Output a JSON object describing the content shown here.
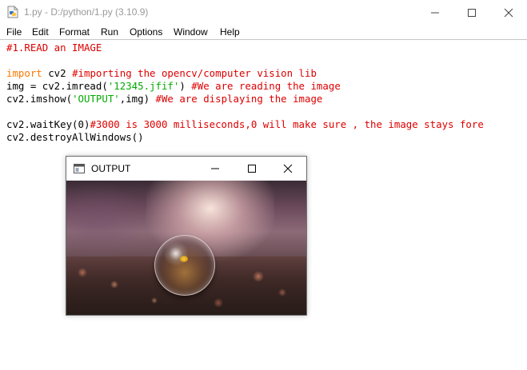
{
  "window": {
    "title": "1.py - D:/python/1.py (3.10.9)",
    "icon": "python-file-icon",
    "controls": [
      "minimize-icon",
      "maximize-icon",
      "close-icon"
    ]
  },
  "menu": {
    "items": [
      "File",
      "Edit",
      "Format",
      "Run",
      "Options",
      "Window",
      "Help"
    ]
  },
  "code": {
    "line1": {
      "comment": "#1.READ an IMAGE"
    },
    "line3": {
      "kw": "import",
      "rest": " cv2 ",
      "comment": "#importing the opencv/computer vision lib"
    },
    "line4": {
      "pre": "img = cv2.imread(",
      "str": "'12345.jfif'",
      "post": ") ",
      "comment": "#We are reading the image"
    },
    "line5": {
      "pre": "cv2.imshow(",
      "str": "'OUTPUT'",
      "post": ",img) ",
      "comment": "#We are displaying the image"
    },
    "line7": {
      "pre": "cv2.waitKey(0)",
      "comment": "#3000 is 3000 milliseconds,0 will make sure , the image stays fore"
    },
    "line8": {
      "pre": "cv2.destroyAllWindows()"
    }
  },
  "output_window": {
    "title": "OUTPUT",
    "icon": "window-icon",
    "controls": [
      "minimize-icon",
      "maximize-icon",
      "close-icon"
    ],
    "image": "bokeh-photo-glass-sphere"
  },
  "colors": {
    "comment": "#dd0000",
    "keyword": "#ff7700",
    "string": "#00aa00",
    "title_text": "#999999"
  }
}
